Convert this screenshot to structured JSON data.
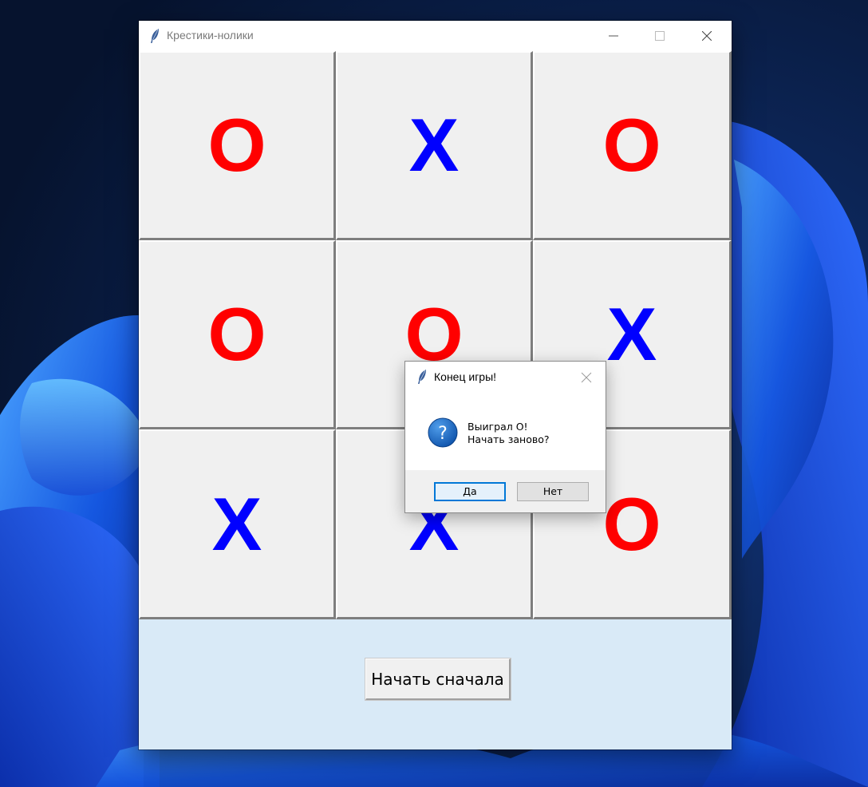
{
  "colors": {
    "o_mark": "#ff0000",
    "x_mark": "#0000ff",
    "bottom_panel": "#d9eaf7",
    "focus_accent": "#0078d7"
  },
  "window": {
    "title": "Крестики-нолики",
    "icon": "feather-icon",
    "controls": [
      "minimize-icon",
      "maximize-icon",
      "close-icon"
    ]
  },
  "board": {
    "cells": [
      "O",
      "X",
      "O",
      "O",
      "O",
      "X",
      "X",
      "X",
      "O"
    ]
  },
  "bottom": {
    "restart_label": "Начать сначала"
  },
  "dialog": {
    "title": "Конец игры!",
    "icon": "question-icon",
    "message_line1": "Выиграл O!",
    "message_line2": "Начать заново?",
    "yes_label": "Да",
    "no_label": "Нет"
  }
}
